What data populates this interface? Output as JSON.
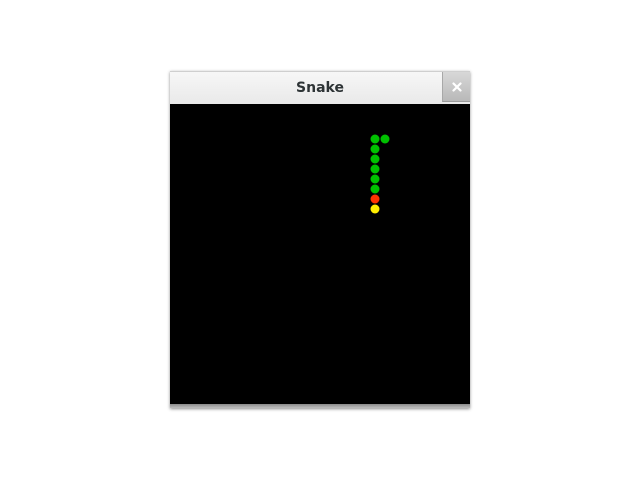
{
  "window": {
    "title": "Snake"
  },
  "game": {
    "grid": {
      "cols": 30,
      "rows": 30
    },
    "snake": {
      "head": [
        20,
        9
      ],
      "body": [
        [
          20,
          3
        ],
        [
          20,
          4
        ],
        [
          20,
          5
        ],
        [
          20,
          6
        ],
        [
          20,
          7
        ],
        [
          20,
          8
        ],
        [
          21,
          3
        ]
      ]
    },
    "food": [
      20,
      10
    ],
    "colors": {
      "background": "#000000",
      "body": "#00c000",
      "head": "#ff3300",
      "food": "#ffee00"
    }
  }
}
